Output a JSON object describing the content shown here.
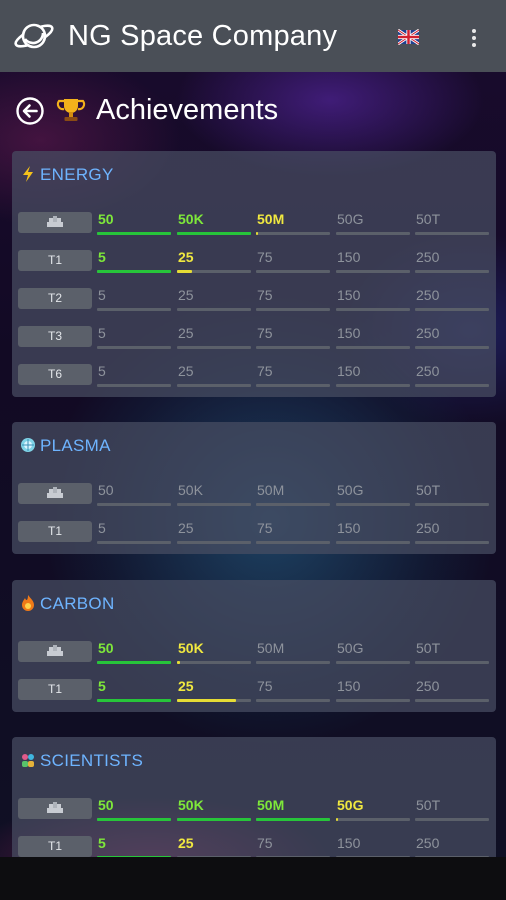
{
  "app": {
    "title": "NG Space Company",
    "logo_icon": "planet-icon",
    "language_flag": "uk-flag-icon",
    "menu_icon": "more-vert-icon"
  },
  "page": {
    "title": "Achievements",
    "back_icon": "back-circle-icon",
    "title_icon": "trophy-icon"
  },
  "sections": [
    {
      "name": "ENERGY",
      "icon": "lightning-icon",
      "rows": [
        {
          "tier": "",
          "tier_icon": "storage-icon",
          "cells": [
            {
              "label": "50",
              "status": "complete",
              "progress": 1
            },
            {
              "label": "50K",
              "status": "complete",
              "progress": 1
            },
            {
              "label": "50M",
              "status": "progress",
              "progress": 0.03
            },
            {
              "label": "50G",
              "status": "locked",
              "progress": 0
            },
            {
              "label": "50T",
              "status": "locked",
              "progress": 0
            }
          ]
        },
        {
          "tier": "T1",
          "cells": [
            {
              "label": "5",
              "status": "complete",
              "progress": 1
            },
            {
              "label": "25",
              "status": "progress",
              "progress": 0.2
            },
            {
              "label": "75",
              "status": "locked",
              "progress": 0
            },
            {
              "label": "150",
              "status": "locked",
              "progress": 0
            },
            {
              "label": "250",
              "status": "locked",
              "progress": 0
            }
          ]
        },
        {
          "tier": "T2",
          "cells": [
            {
              "label": "5",
              "status": "locked",
              "progress": 0
            },
            {
              "label": "25",
              "status": "locked",
              "progress": 0
            },
            {
              "label": "75",
              "status": "locked",
              "progress": 0
            },
            {
              "label": "150",
              "status": "locked",
              "progress": 0
            },
            {
              "label": "250",
              "status": "locked",
              "progress": 0
            }
          ]
        },
        {
          "tier": "T3",
          "cells": [
            {
              "label": "5",
              "status": "locked",
              "progress": 0
            },
            {
              "label": "25",
              "status": "locked",
              "progress": 0
            },
            {
              "label": "75",
              "status": "locked",
              "progress": 0
            },
            {
              "label": "150",
              "status": "locked",
              "progress": 0
            },
            {
              "label": "250",
              "status": "locked",
              "progress": 0
            }
          ]
        },
        {
          "tier": "T6",
          "cells": [
            {
              "label": "5",
              "status": "locked",
              "progress": 0
            },
            {
              "label": "25",
              "status": "locked",
              "progress": 0
            },
            {
              "label": "75",
              "status": "locked",
              "progress": 0
            },
            {
              "label": "150",
              "status": "locked",
              "progress": 0
            },
            {
              "label": "250",
              "status": "locked",
              "progress": 0
            }
          ]
        }
      ]
    },
    {
      "name": "PLASMA",
      "icon": "plasma-orb-icon",
      "rows": [
        {
          "tier": "",
          "tier_icon": "storage-icon",
          "cells": [
            {
              "label": "50",
              "status": "locked",
              "progress": 0
            },
            {
              "label": "50K",
              "status": "locked",
              "progress": 0
            },
            {
              "label": "50M",
              "status": "locked",
              "progress": 0
            },
            {
              "label": "50G",
              "status": "locked",
              "progress": 0
            },
            {
              "label": "50T",
              "status": "locked",
              "progress": 0
            }
          ]
        },
        {
          "tier": "T1",
          "cells": [
            {
              "label": "5",
              "status": "locked",
              "progress": 0
            },
            {
              "label": "25",
              "status": "locked",
              "progress": 0
            },
            {
              "label": "75",
              "status": "locked",
              "progress": 0
            },
            {
              "label": "150",
              "status": "locked",
              "progress": 0
            },
            {
              "label": "250",
              "status": "locked",
              "progress": 0
            }
          ]
        }
      ]
    },
    {
      "name": "CARBON",
      "icon": "carbon-fire-icon",
      "rows": [
        {
          "tier": "",
          "tier_icon": "storage-icon",
          "cells": [
            {
              "label": "50",
              "status": "complete",
              "progress": 1
            },
            {
              "label": "50K",
              "status": "progress",
              "progress": 0.04
            },
            {
              "label": "50M",
              "status": "locked",
              "progress": 0
            },
            {
              "label": "50G",
              "status": "locked",
              "progress": 0
            },
            {
              "label": "50T",
              "status": "locked",
              "progress": 0
            }
          ]
        },
        {
          "tier": "T1",
          "cells": [
            {
              "label": "5",
              "status": "complete",
              "progress": 1
            },
            {
              "label": "25",
              "status": "progress",
              "progress": 0.8
            },
            {
              "label": "75",
              "status": "locked",
              "progress": 0
            },
            {
              "label": "150",
              "status": "locked",
              "progress": 0
            },
            {
              "label": "250",
              "status": "locked",
              "progress": 0
            }
          ]
        }
      ]
    },
    {
      "name": "SCIENTISTS",
      "icon": "scientists-icon",
      "rows": [
        {
          "tier": "",
          "tier_icon": "storage-icon",
          "cells": [
            {
              "label": "50",
              "status": "complete",
              "progress": 1
            },
            {
              "label": "50K",
              "status": "complete",
              "progress": 1
            },
            {
              "label": "50M",
              "status": "complete",
              "progress": 1
            },
            {
              "label": "50G",
              "status": "progress",
              "progress": 0.03
            },
            {
              "label": "50T",
              "status": "locked",
              "progress": 0
            }
          ]
        },
        {
          "tier": "T1",
          "cells": [
            {
              "label": "5",
              "status": "complete",
              "progress": 1
            },
            {
              "label": "25",
              "status": "progress",
              "progress": 0
            },
            {
              "label": "75",
              "status": "locked",
              "progress": 0
            },
            {
              "label": "150",
              "status": "locked",
              "progress": 0
            },
            {
              "label": "250",
              "status": "locked",
              "progress": 0
            }
          ]
        }
      ]
    }
  ]
}
